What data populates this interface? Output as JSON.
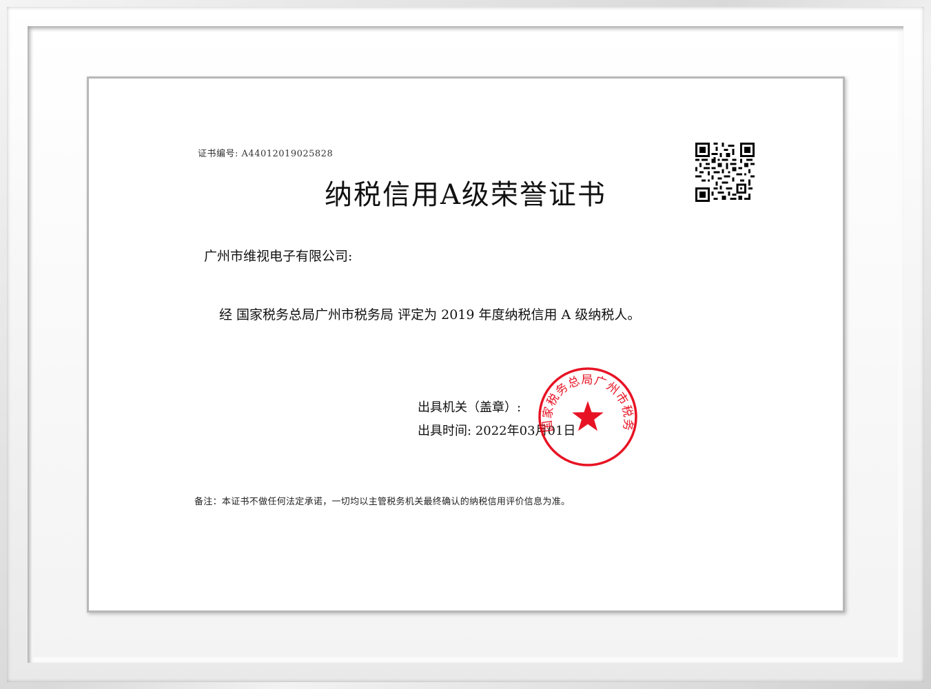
{
  "certificate": {
    "number_label": "证书编号:",
    "number": "A44012019025828",
    "title": "纳税信用A级荣誉证书",
    "recipient": "广州市维视电子有限公司:",
    "statement": "经 国家税务总局广州市税务局 评定为 2019 年度纳税信用 A 级纳税人。",
    "issuer_label": "出具机关（盖章）:",
    "issue_date_label": "出具时间:",
    "issue_date": "2022年03月01日",
    "remark": "备注：本证书不做任何法定承诺，一切均以主管税务机关最终确认的纳税信用评价信息为准。",
    "seal_text": "国家税务总局广州市税务局"
  },
  "colors": {
    "seal_red": "#e60012",
    "frame_grey": "#d9d9d9"
  },
  "icons": {
    "qr": "qr-code-icon",
    "seal": "official-seal-icon"
  }
}
